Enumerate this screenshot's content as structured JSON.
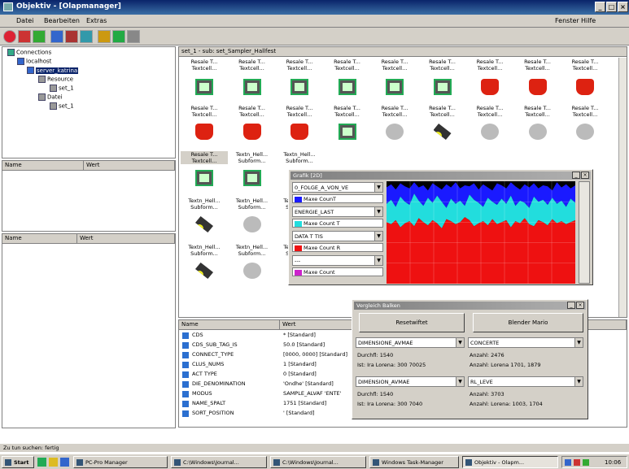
{
  "window": {
    "title": "Objektiv - [Olapmanager]"
  },
  "menu": {
    "items": [
      "Datei",
      "Bearbeiten",
      "Extras"
    ],
    "right_items": [
      "Fenster",
      "Hilfe"
    ]
  },
  "tree": {
    "items": [
      {
        "label": "Connections",
        "indent": 0
      },
      {
        "label": "localhost",
        "indent": 1
      },
      {
        "label": "server_katrina",
        "indent": 2
      },
      {
        "label": "Resource",
        "indent": 3
      },
      {
        "label": "set_1",
        "indent": 4
      },
      {
        "label": "Datei",
        "indent": 3
      },
      {
        "label": "set_1",
        "indent": 4
      }
    ]
  },
  "panes": {
    "mid_headers": [
      "Name",
      "Wert"
    ],
    "low_headers": [
      "Name",
      "Wert"
    ]
  },
  "path_bar": "set_1 - sub: set_Sampler_Hallfest",
  "grid": {
    "row1_label_top": "Resale T...",
    "row1_label_bottom": "Textcell...",
    "row2_label_top": "Textn_Hell...",
    "row2_label_bottom": "Subform...",
    "selected_label_top": "Resale T...",
    "selected_label_bottom": "Textcell..."
  },
  "graph": {
    "title": "Grafik [2D]",
    "combos": [
      "0_FOLGE_A_VON_VE",
      "ENERGIE_LAST",
      "DATA T TIS",
      "---"
    ],
    "legends": [
      {
        "label": "Maxe CounT",
        "color": "#1a1aff"
      },
      {
        "label": "Maxe Count T",
        "color": "#22dddd"
      },
      {
        "label": "Maxe Count R",
        "color": "#ee1111"
      },
      {
        "label": "Maxe Count",
        "color": "#cc22cc"
      }
    ],
    "series": {
      "red_top_pct": [
        40,
        42,
        38,
        45,
        41,
        39,
        44,
        36,
        40,
        43,
        38,
        41,
        46,
        37,
        39,
        42,
        40,
        35,
        38,
        44,
        41,
        39,
        43,
        37,
        42,
        40,
        38,
        45,
        39,
        41,
        36,
        42,
        44,
        38,
        40,
        43,
        37,
        41,
        39,
        42,
        40,
        38
      ],
      "cyan_top_pct": [
        22,
        18,
        25,
        15,
        20,
        23,
        12,
        19,
        24,
        16,
        21,
        14,
        20,
        26,
        17,
        22,
        19,
        24,
        13,
        18,
        21,
        25,
        16,
        20,
        23,
        17,
        22,
        14,
        24,
        19,
        21,
        26,
        15,
        20,
        18,
        23,
        16,
        22,
        19,
        25,
        17,
        21
      ],
      "blue_top_pct": [
        6,
        3,
        8,
        2,
        5,
        7,
        1,
        6,
        4,
        9,
        2,
        5,
        8,
        3,
        6,
        1,
        7,
        4,
        5,
        2,
        8,
        3,
        6,
        9,
        2,
        4,
        7,
        1,
        5,
        8,
        3,
        6,
        2,
        7,
        4,
        5,
        9,
        1,
        6,
        3,
        7,
        4
      ]
    }
  },
  "compare": {
    "title": "Vergleich Balken",
    "btn_left": "Resetwiftet",
    "btn_right": "Blender Mario",
    "combo1": "DIMENSIONE_AVMAE",
    "combo2": "CONCERTE",
    "combo3": "DIMENSION_AVMAE",
    "combo4": "RL_LEVE",
    "l1a": "Durchfl: 1540",
    "l1b": "Ist: Ira Lorena: 300 70025",
    "r1a": "Anzahl: 2476",
    "r1b": "Anzahl: Lorena 1701, 1879",
    "l2a": "Durchfl: 1540",
    "l2b": "Ist: Ira Lorena: 300 7040",
    "r2a": "Anzahl: 3703",
    "r2b": "Anzahl: Lorena: 1003, 1704"
  },
  "props": {
    "headers": [
      "Name",
      "Wert"
    ],
    "rows": [
      {
        "name": "CDS",
        "value": "* [Standard]"
      },
      {
        "name": "CDS_SUB_TAG_IS",
        "value": "50.0 [Standard]"
      },
      {
        "name": "CONNECT_TYPE",
        "value": "[0000, 0000] [Standard]"
      },
      {
        "name": "CLUS_NUMS",
        "value": "1 [Standard]"
      },
      {
        "name": "ACT TYPE",
        "value": "0 [Standard]"
      },
      {
        "name": "DIE_DENOMINATION",
        "value": "'Ondhe' [Standard]"
      },
      {
        "name": "MODUS",
        "value": "SAMPLE_ALVAF 'ENTE'"
      },
      {
        "name": "NAME_SPALT",
        "value": "1751 [Standard]"
      },
      {
        "name": "SORT_POSITION",
        "value": "' [Standard]"
      }
    ]
  },
  "status": {
    "text": "Zu tun suchen: fertig"
  },
  "taskbar": {
    "start": "Start",
    "items": [
      "PC-Pro Manager",
      "C:\\Windows\\Journal...",
      "C:\\Windows\\Journal...",
      "Windows Task-Manager",
      "Objektiv - Olapm..."
    ],
    "clock": "10:06"
  }
}
